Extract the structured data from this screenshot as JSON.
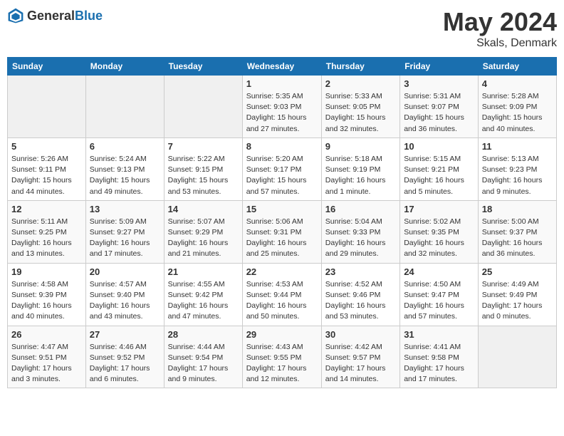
{
  "header": {
    "logo_general": "General",
    "logo_blue": "Blue",
    "month": "May 2024",
    "location": "Skals, Denmark"
  },
  "weekdays": [
    "Sunday",
    "Monday",
    "Tuesday",
    "Wednesday",
    "Thursday",
    "Friday",
    "Saturday"
  ],
  "weeks": [
    [
      {
        "day": "",
        "sunrise": "",
        "sunset": "",
        "daylight": ""
      },
      {
        "day": "",
        "sunrise": "",
        "sunset": "",
        "daylight": ""
      },
      {
        "day": "",
        "sunrise": "",
        "sunset": "",
        "daylight": ""
      },
      {
        "day": "1",
        "sunrise": "Sunrise: 5:35 AM",
        "sunset": "Sunset: 9:03 PM",
        "daylight": "Daylight: 15 hours and 27 minutes."
      },
      {
        "day": "2",
        "sunrise": "Sunrise: 5:33 AM",
        "sunset": "Sunset: 9:05 PM",
        "daylight": "Daylight: 15 hours and 32 minutes."
      },
      {
        "day": "3",
        "sunrise": "Sunrise: 5:31 AM",
        "sunset": "Sunset: 9:07 PM",
        "daylight": "Daylight: 15 hours and 36 minutes."
      },
      {
        "day": "4",
        "sunrise": "Sunrise: 5:28 AM",
        "sunset": "Sunset: 9:09 PM",
        "daylight": "Daylight: 15 hours and 40 minutes."
      }
    ],
    [
      {
        "day": "5",
        "sunrise": "Sunrise: 5:26 AM",
        "sunset": "Sunset: 9:11 PM",
        "daylight": "Daylight: 15 hours and 44 minutes."
      },
      {
        "day": "6",
        "sunrise": "Sunrise: 5:24 AM",
        "sunset": "Sunset: 9:13 PM",
        "daylight": "Daylight: 15 hours and 49 minutes."
      },
      {
        "day": "7",
        "sunrise": "Sunrise: 5:22 AM",
        "sunset": "Sunset: 9:15 PM",
        "daylight": "Daylight: 15 hours and 53 minutes."
      },
      {
        "day": "8",
        "sunrise": "Sunrise: 5:20 AM",
        "sunset": "Sunset: 9:17 PM",
        "daylight": "Daylight: 15 hours and 57 minutes."
      },
      {
        "day": "9",
        "sunrise": "Sunrise: 5:18 AM",
        "sunset": "Sunset: 9:19 PM",
        "daylight": "Daylight: 16 hours and 1 minute."
      },
      {
        "day": "10",
        "sunrise": "Sunrise: 5:15 AM",
        "sunset": "Sunset: 9:21 PM",
        "daylight": "Daylight: 16 hours and 5 minutes."
      },
      {
        "day": "11",
        "sunrise": "Sunrise: 5:13 AM",
        "sunset": "Sunset: 9:23 PM",
        "daylight": "Daylight: 16 hours and 9 minutes."
      }
    ],
    [
      {
        "day": "12",
        "sunrise": "Sunrise: 5:11 AM",
        "sunset": "Sunset: 9:25 PM",
        "daylight": "Daylight: 16 hours and 13 minutes."
      },
      {
        "day": "13",
        "sunrise": "Sunrise: 5:09 AM",
        "sunset": "Sunset: 9:27 PM",
        "daylight": "Daylight: 16 hours and 17 minutes."
      },
      {
        "day": "14",
        "sunrise": "Sunrise: 5:07 AM",
        "sunset": "Sunset: 9:29 PM",
        "daylight": "Daylight: 16 hours and 21 minutes."
      },
      {
        "day": "15",
        "sunrise": "Sunrise: 5:06 AM",
        "sunset": "Sunset: 9:31 PM",
        "daylight": "Daylight: 16 hours and 25 minutes."
      },
      {
        "day": "16",
        "sunrise": "Sunrise: 5:04 AM",
        "sunset": "Sunset: 9:33 PM",
        "daylight": "Daylight: 16 hours and 29 minutes."
      },
      {
        "day": "17",
        "sunrise": "Sunrise: 5:02 AM",
        "sunset": "Sunset: 9:35 PM",
        "daylight": "Daylight: 16 hours and 32 minutes."
      },
      {
        "day": "18",
        "sunrise": "Sunrise: 5:00 AM",
        "sunset": "Sunset: 9:37 PM",
        "daylight": "Daylight: 16 hours and 36 minutes."
      }
    ],
    [
      {
        "day": "19",
        "sunrise": "Sunrise: 4:58 AM",
        "sunset": "Sunset: 9:39 PM",
        "daylight": "Daylight: 16 hours and 40 minutes."
      },
      {
        "day": "20",
        "sunrise": "Sunrise: 4:57 AM",
        "sunset": "Sunset: 9:40 PM",
        "daylight": "Daylight: 16 hours and 43 minutes."
      },
      {
        "day": "21",
        "sunrise": "Sunrise: 4:55 AM",
        "sunset": "Sunset: 9:42 PM",
        "daylight": "Daylight: 16 hours and 47 minutes."
      },
      {
        "day": "22",
        "sunrise": "Sunrise: 4:53 AM",
        "sunset": "Sunset: 9:44 PM",
        "daylight": "Daylight: 16 hours and 50 minutes."
      },
      {
        "day": "23",
        "sunrise": "Sunrise: 4:52 AM",
        "sunset": "Sunset: 9:46 PM",
        "daylight": "Daylight: 16 hours and 53 minutes."
      },
      {
        "day": "24",
        "sunrise": "Sunrise: 4:50 AM",
        "sunset": "Sunset: 9:47 PM",
        "daylight": "Daylight: 16 hours and 57 minutes."
      },
      {
        "day": "25",
        "sunrise": "Sunrise: 4:49 AM",
        "sunset": "Sunset: 9:49 PM",
        "daylight": "Daylight: 17 hours and 0 minutes."
      }
    ],
    [
      {
        "day": "26",
        "sunrise": "Sunrise: 4:47 AM",
        "sunset": "Sunset: 9:51 PM",
        "daylight": "Daylight: 17 hours and 3 minutes."
      },
      {
        "day": "27",
        "sunrise": "Sunrise: 4:46 AM",
        "sunset": "Sunset: 9:52 PM",
        "daylight": "Daylight: 17 hours and 6 minutes."
      },
      {
        "day": "28",
        "sunrise": "Sunrise: 4:44 AM",
        "sunset": "Sunset: 9:54 PM",
        "daylight": "Daylight: 17 hours and 9 minutes."
      },
      {
        "day": "29",
        "sunrise": "Sunrise: 4:43 AM",
        "sunset": "Sunset: 9:55 PM",
        "daylight": "Daylight: 17 hours and 12 minutes."
      },
      {
        "day": "30",
        "sunrise": "Sunrise: 4:42 AM",
        "sunset": "Sunset: 9:57 PM",
        "daylight": "Daylight: 17 hours and 14 minutes."
      },
      {
        "day": "31",
        "sunrise": "Sunrise: 4:41 AM",
        "sunset": "Sunset: 9:58 PM",
        "daylight": "Daylight: 17 hours and 17 minutes."
      },
      {
        "day": "",
        "sunrise": "",
        "sunset": "",
        "daylight": ""
      }
    ]
  ]
}
